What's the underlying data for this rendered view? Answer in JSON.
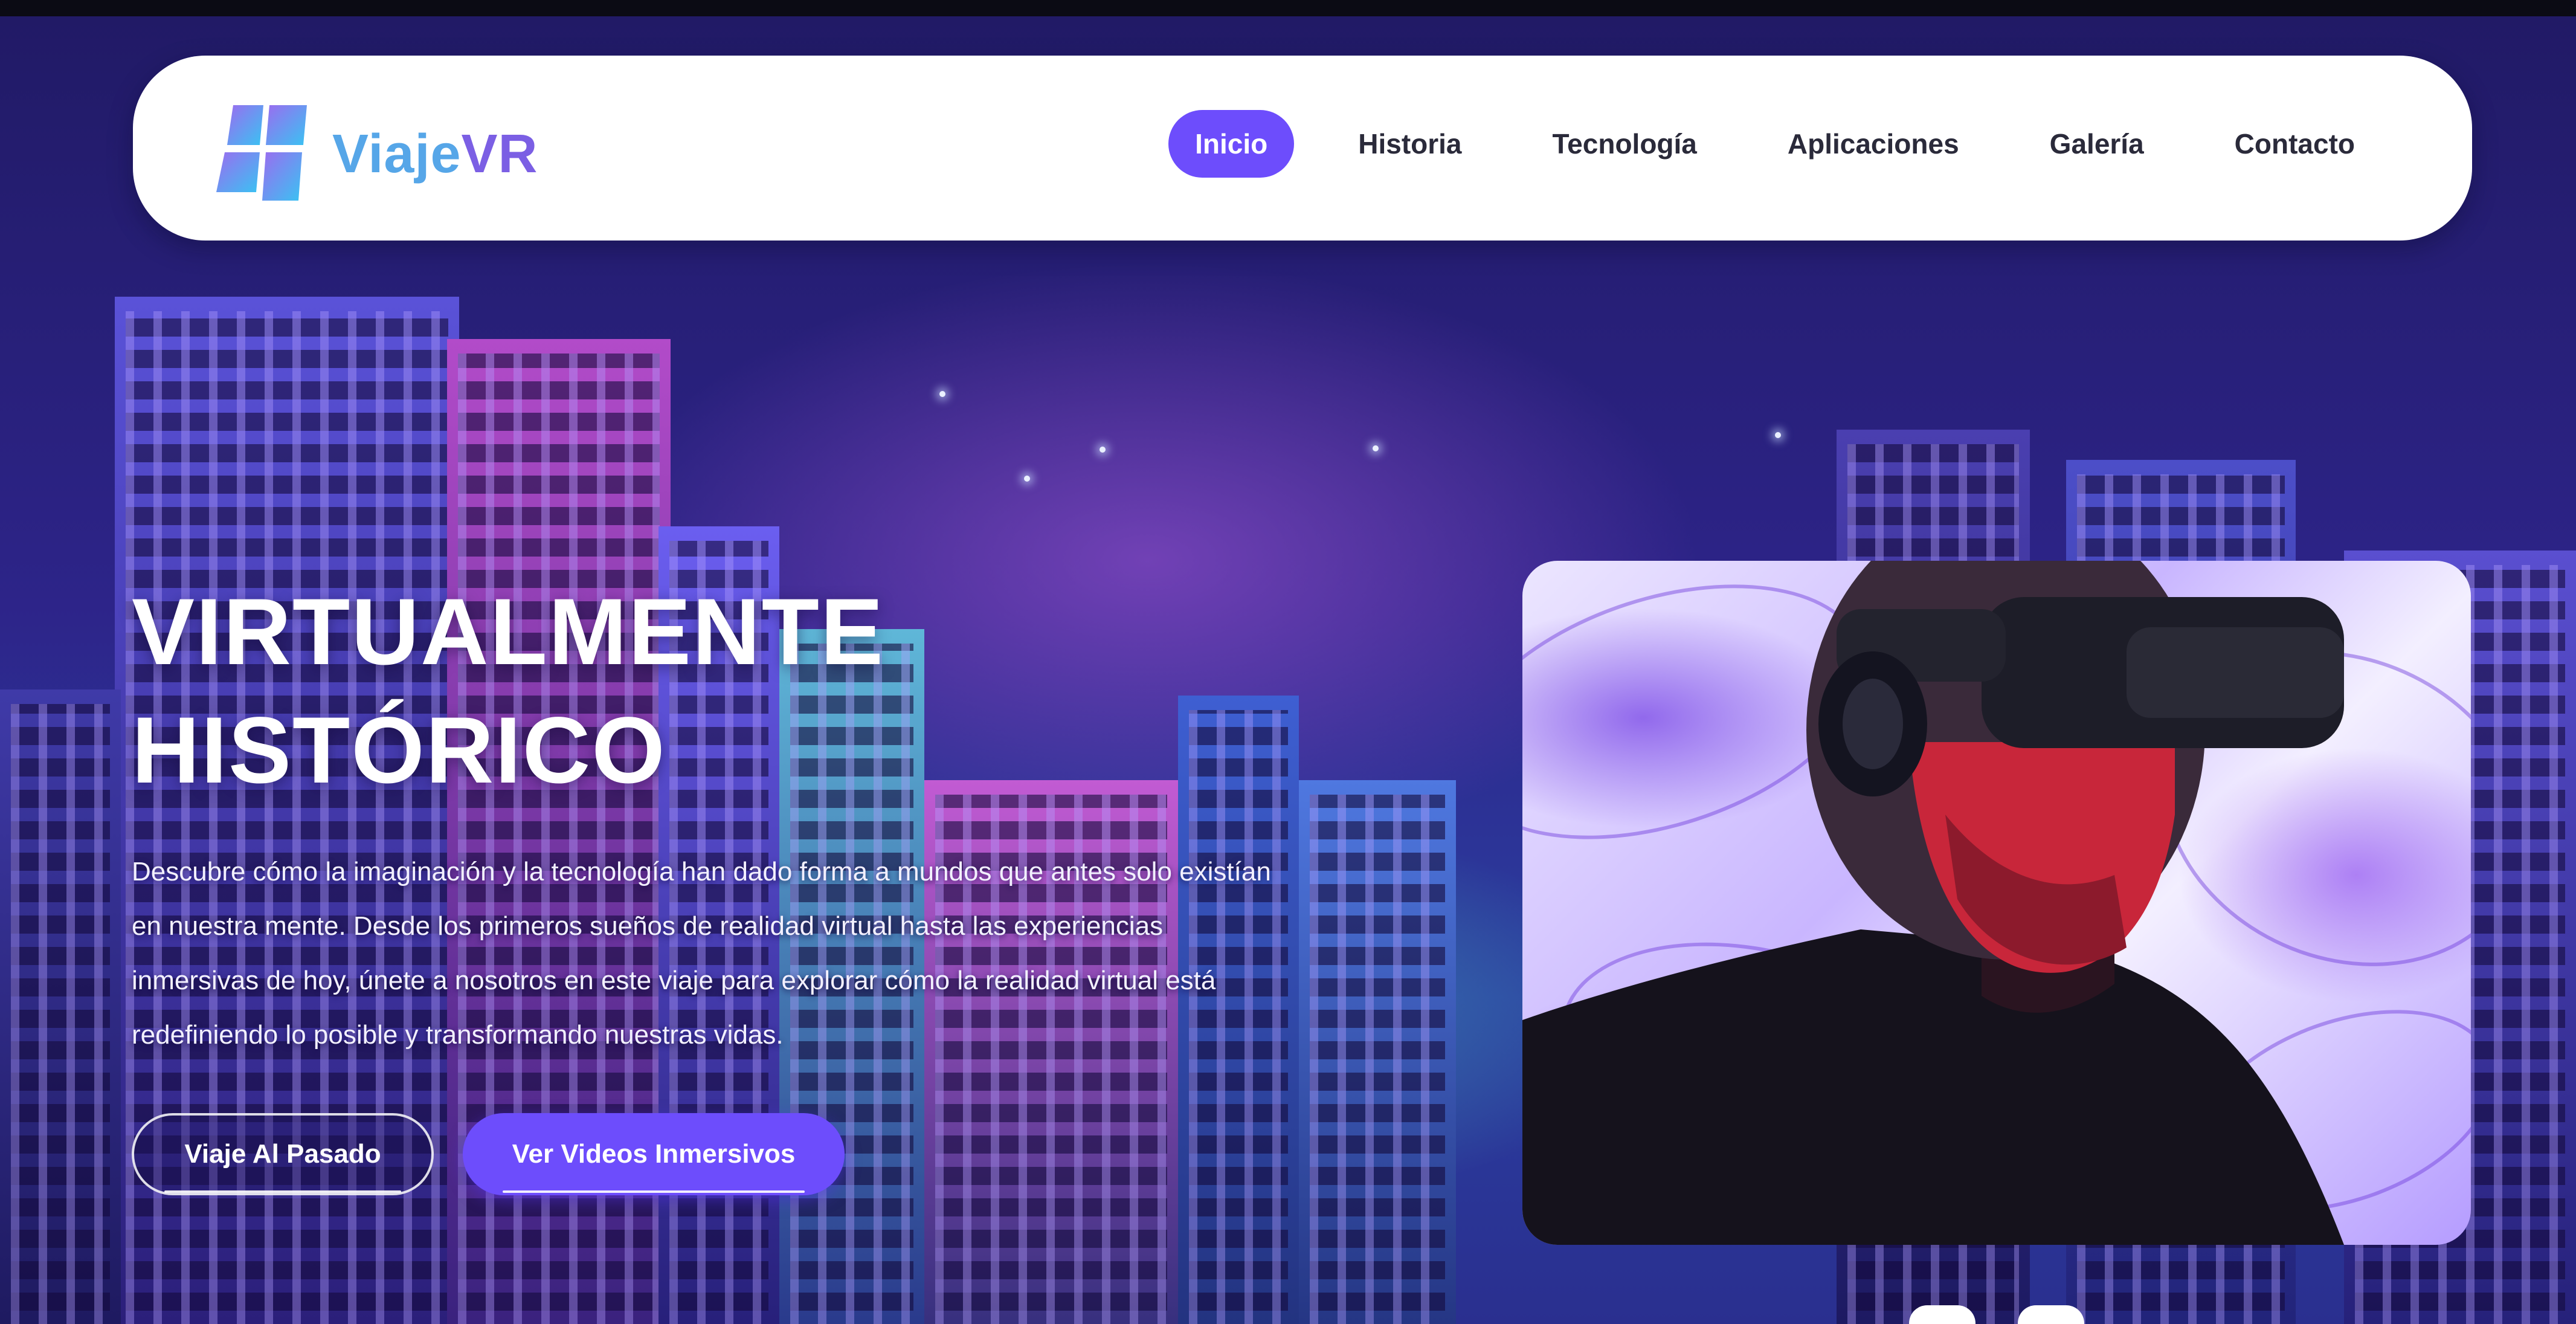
{
  "brand": {
    "name_part1": "Viaje",
    "name_part2": "VR",
    "logo_icon": "grid-logo-icon"
  },
  "nav": {
    "items": [
      {
        "label": "Inicio",
        "active": true
      },
      {
        "label": "Historia"
      },
      {
        "label": "Tecnología"
      },
      {
        "label": "Aplicaciones"
      },
      {
        "label": "Galería"
      },
      {
        "label": "Contacto"
      }
    ]
  },
  "hero": {
    "title_line1": "VIRTUALMENTE",
    "title_line2": "HISTÓRICO",
    "description": "Descubre cómo la imaginación y la tecnología han dado forma a mundos que antes solo existían en nuestra mente. Desde los primeros sueños de realidad virtual hasta las experiencias inmersivas de hoy, únete a nosotros en este viaje para explorar cómo la realidad virtual está redefiniendo lo posible y transformando nuestras vidas.",
    "buttons": {
      "primary_outline": "Viaje Al Pasado",
      "primary_solid": "Ver Videos Inmersivos"
    }
  },
  "media": {
    "image_subject": "man-wearing-vr-headset"
  },
  "colors": {
    "accent": "#6d4dfc",
    "logo_blue": "#56a6e8",
    "logo_purple": "#7b5fe4",
    "background": "#241e6a"
  }
}
